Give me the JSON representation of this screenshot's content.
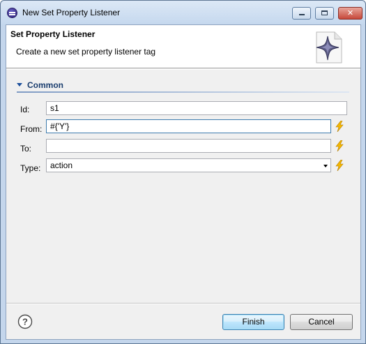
{
  "window": {
    "title": "New Set Property Listener"
  },
  "header": {
    "title": "Set Property Listener",
    "description": "Create a new set property listener tag"
  },
  "section": {
    "title": "Common"
  },
  "form": {
    "id": {
      "label": "Id:",
      "value": "s1"
    },
    "from": {
      "label": "From:",
      "value": "#{'Y'}"
    },
    "to": {
      "label": "To:",
      "value": ""
    },
    "type": {
      "label": "Type:",
      "value": "action"
    }
  },
  "footer": {
    "finish_label": "Finish",
    "cancel_label": "Cancel"
  },
  "icons": {
    "app": "eclipse-icon",
    "wizard": "wizard-star-icon",
    "expression": "lightning-bolt-icon",
    "help": "help-icon"
  },
  "colors": {
    "section_title": "#1a3d6e",
    "bolt": "#f5b800",
    "close_button": "#c7483a"
  }
}
